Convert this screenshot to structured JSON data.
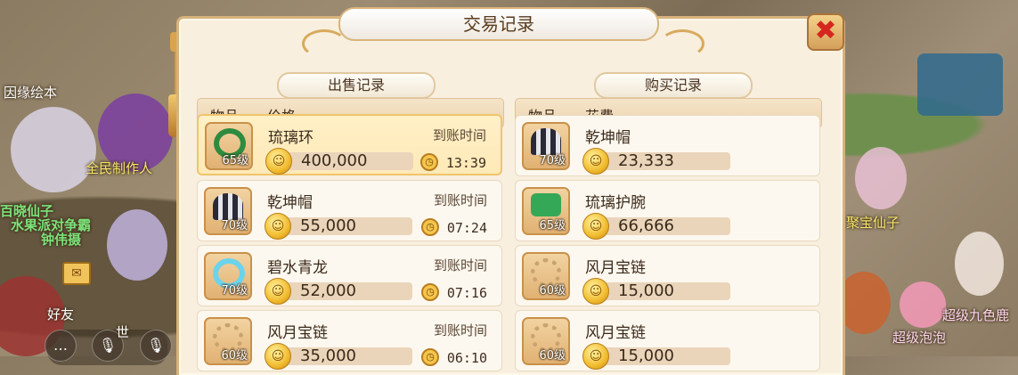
{
  "dialog": {
    "title": "交易记录",
    "close_symbol": "✖"
  },
  "sell": {
    "title": "出售记录",
    "col_item": "物品",
    "col_price": "价格",
    "time_label": "到账时间",
    "rows": [
      {
        "name": "琉璃环",
        "level": "65级",
        "price": "400,000",
        "time": "13:39",
        "icon_color": "#2e8b3f"
      },
      {
        "name": "乾坤帽",
        "level": "70级",
        "price": "55,000",
        "time": "07:24",
        "icon_color": "#2c2c3b"
      },
      {
        "name": "碧水青龙",
        "level": "70级",
        "price": "52,000",
        "time": "07:16",
        "icon_color": "#58c7e0"
      },
      {
        "name": "风月宝链",
        "level": "60级",
        "price": "35,000",
        "time": "06:10",
        "icon_color": "#c9a36d"
      }
    ]
  },
  "buy": {
    "title": "购买记录",
    "col_item": "物品",
    "col_cost": "花费",
    "rows": [
      {
        "name": "乾坤帽",
        "level": "70级",
        "price": "23,333",
        "icon_color": "#2c2c3b"
      },
      {
        "name": "琉璃护腕",
        "level": "65级",
        "price": "66,666",
        "icon_color": "#34a857"
      },
      {
        "name": "风月宝链",
        "level": "60级",
        "price": "15,000",
        "icon_color": "#c9a36d"
      },
      {
        "name": "风月宝链",
        "level": "60级",
        "price": "15,000",
        "icon_color": "#c9a36d"
      }
    ]
  },
  "scene": {
    "labels": [
      "因缘绘本",
      "全民制作人",
      "百晓仙子",
      "水果派对争霸",
      "钟伟摄",
      "好友",
      "世",
      "聚宝仙子",
      "超级九色鹿",
      "超级泡泡"
    ]
  },
  "colors": {
    "panel_bg": "#f8efdf",
    "selected_row": "#ffe9b7",
    "accent_gold": "#d7b27d",
    "close_red": "#d5271f"
  }
}
